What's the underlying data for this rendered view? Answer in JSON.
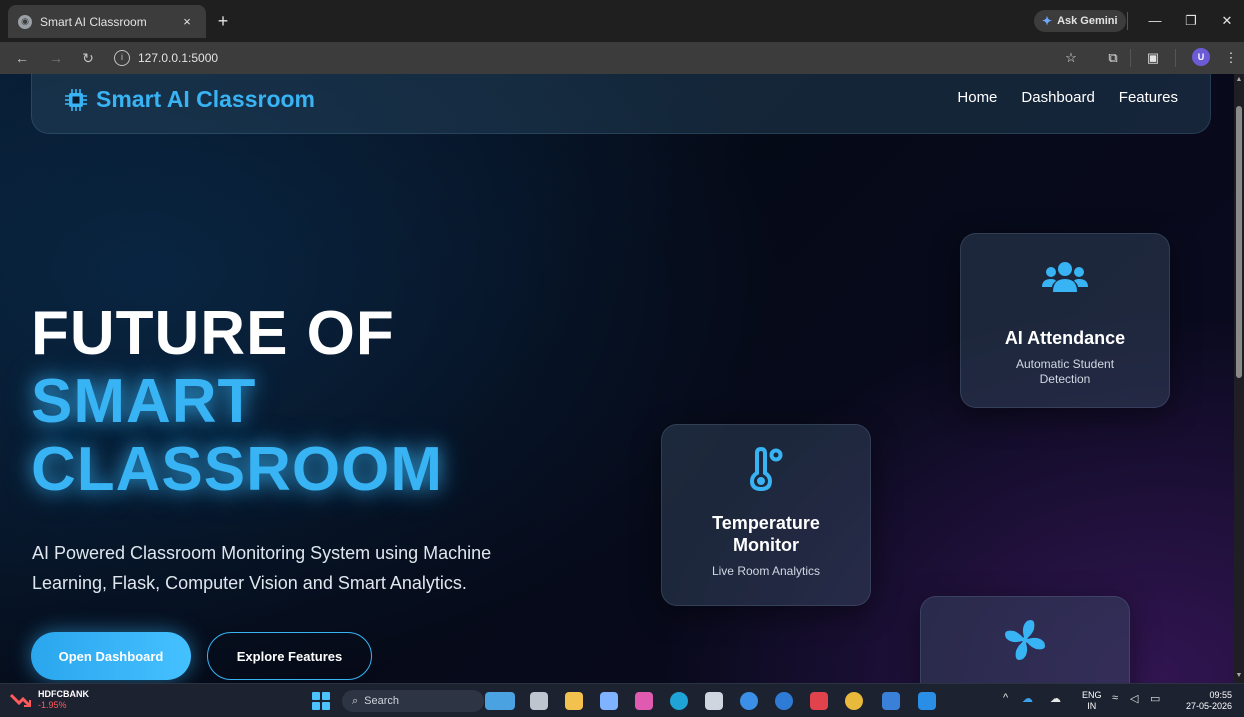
{
  "browser": {
    "tab_title": "Smart AI Classroom",
    "tab_close": "×",
    "new_tab": "+",
    "gemini_label": "Ask Gemini",
    "url": "127.0.0.1:5000",
    "profile_initial": "U"
  },
  "site": {
    "brand": "Smart AI Classroom",
    "nav": [
      "Home",
      "Dashboard",
      "Features"
    ],
    "hero": {
      "line1": "FUTURE OF",
      "line2": "SMART",
      "line3": "CLASSROOM",
      "subtitle": "AI Powered Classroom Monitoring System using Machine Learning, Flask, Computer Vision and Smart Analytics."
    },
    "buttons": {
      "primary": "Open Dashboard",
      "secondary": "Explore Features"
    },
    "cards": [
      {
        "title": "AI Attendance",
        "desc": "Automatic Student Detection",
        "icon": "users-icon"
      },
      {
        "title": "Temperature Monitor",
        "desc": "Live Room Analytics",
        "icon": "thermometer-icon"
      },
      {
        "title": "",
        "desc": "",
        "icon": "fan-icon"
      }
    ],
    "accent_color": "#38b3f4"
  },
  "taskbar": {
    "stock_name": "HDFCBANK",
    "stock_change": "-1.95%",
    "search_placeholder": "Search",
    "lang_top": "ENG",
    "lang_bottom": "IN",
    "time": "09:55",
    "date": "27-05-2026"
  }
}
